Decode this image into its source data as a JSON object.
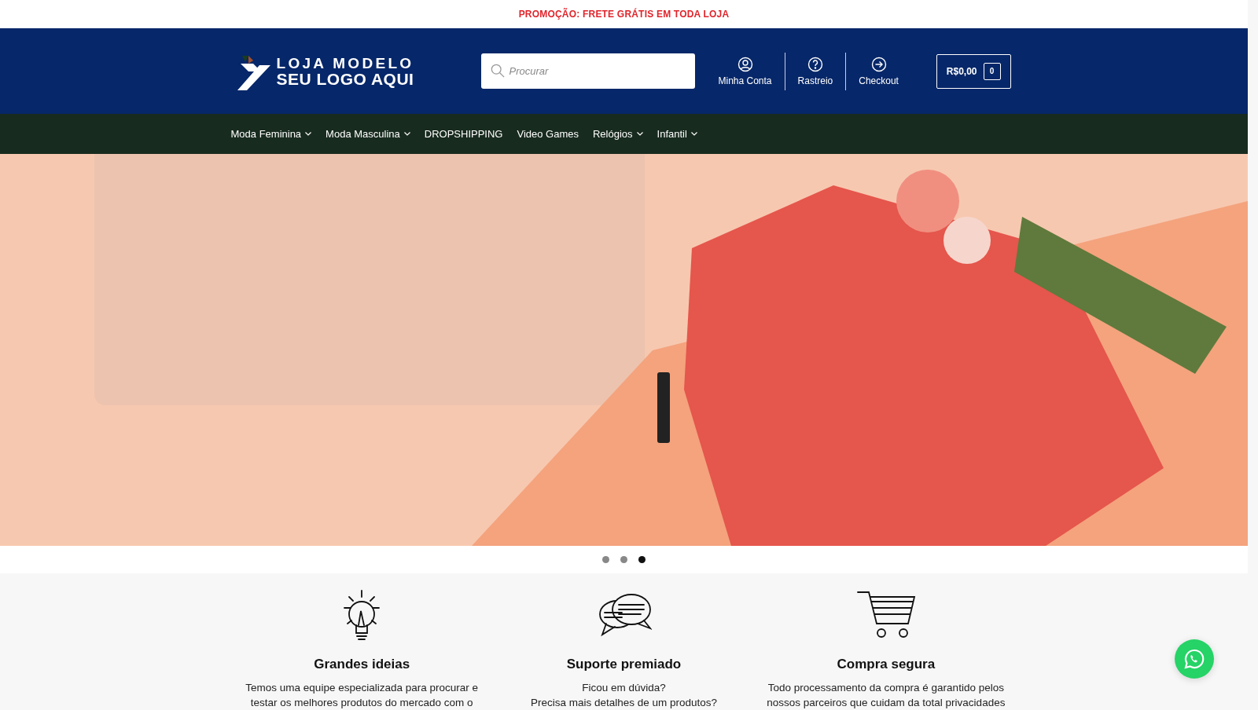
{
  "promo_bar": {
    "text": "PROMOÇÃO: FRETE GRÁTIS EM TODA LOJA"
  },
  "header": {
    "logo": {
      "line_1": "LOJA MODELO",
      "line_2": "SEU LOGO AQUI"
    },
    "search": {
      "placeholder": "Procurar"
    },
    "links": [
      {
        "kind": "account",
        "label": "Minha Conta"
      },
      {
        "kind": "help",
        "label": "Rastreio"
      },
      {
        "kind": "checkout",
        "label": "Checkout"
      }
    ],
    "cart": {
      "total": "R$0,00",
      "count": "0"
    }
  },
  "nav": {
    "items": [
      {
        "label": "Moda Feminina",
        "has_submenu": true
      },
      {
        "label": "Moda Masculina",
        "has_submenu": true
      },
      {
        "label": "DROPSHIPPING",
        "has_submenu": false
      },
      {
        "label": "Video Games",
        "has_submenu": false
      },
      {
        "label": "Relógios",
        "has_submenu": true
      },
      {
        "label": "Infantil",
        "has_submenu": true
      }
    ]
  },
  "slider": {
    "dots": [
      {
        "selected": false
      },
      {
        "selected": false
      },
      {
        "selected": true
      }
    ]
  },
  "features": [
    {
      "kind": "idea",
      "title": "Grandes ideias",
      "lines": [
        "Temos uma equipe especializada para procurar e",
        "testar os melhores produtos do mercado com o"
      ]
    },
    {
      "kind": "chat",
      "title": "Suporte premiado",
      "lines": [
        "Ficou em dúvida?",
        "Precisa mais detalhes de um produtos?"
      ]
    },
    {
      "kind": "cart",
      "title": "Compra segura",
      "lines": [
        "Todo processamento da compra é garantido pelos",
        "nossos parceiros que cuidam da total privacidades"
      ]
    }
  ]
}
